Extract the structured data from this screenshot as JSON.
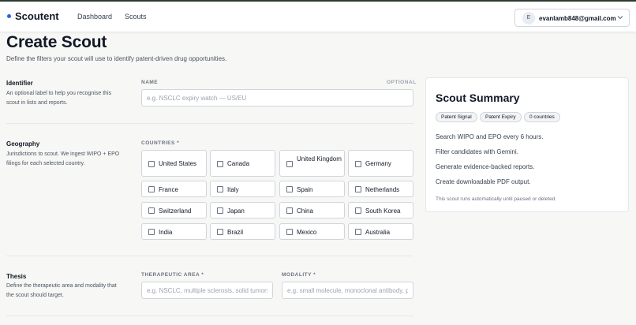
{
  "nav": {
    "brand": "Scoutent",
    "links": [
      "Dashboard",
      "Scouts"
    ],
    "account_initial": "E",
    "account_email": "evanlamb848@gmail.com",
    "brand_color": "#2563eb"
  },
  "page": {
    "title": "Create Scout",
    "subtitle": "Define the filters your scout will use to identify patent-driven drug opportunities."
  },
  "identifier": {
    "title": "Identifier",
    "description": "An optional label to help you recognise this scout in lists and reports.",
    "field_label": "NAME",
    "optional_tag": "OPTIONAL",
    "placeholder": "e.g. NSCLC expiry watch — US/EU",
    "value": ""
  },
  "geography": {
    "title": "Geography",
    "description": "Jurisdictions to scout. We ingest WIPO + EPO filings for each selected country.",
    "field_label": "COUNTRIES *",
    "countries": [
      {
        "label": "United States",
        "checked": false
      },
      {
        "label": "Canada",
        "checked": false
      },
      {
        "label": "United Kingdom",
        "checked": false
      },
      {
        "label": "Germany",
        "checked": false
      },
      {
        "label": "France",
        "checked": false
      },
      {
        "label": "Italy",
        "checked": false
      },
      {
        "label": "Spain",
        "checked": false
      },
      {
        "label": "Netherlands",
        "checked": false
      },
      {
        "label": "Switzerland",
        "checked": false
      },
      {
        "label": "Japan",
        "checked": false
      },
      {
        "label": "China",
        "checked": false
      },
      {
        "label": "South Korea",
        "checked": false
      },
      {
        "label": "India",
        "checked": false
      },
      {
        "label": "Brazil",
        "checked": false
      },
      {
        "label": "Mexico",
        "checked": false
      },
      {
        "label": "Australia",
        "checked": false
      }
    ]
  },
  "thesis": {
    "title": "Thesis",
    "description": "Define the therapeutic area and modality that the scout should target.",
    "therapeutic_label": "THERAPEUTIC AREA *",
    "therapeutic_placeholder": "e.g. NSCLC, multiple sclerosis, solid tumors.",
    "modality_label": "MODALITY *",
    "modality_placeholder": "e.g. small molecule, monoclonal antibody, p"
  },
  "summary": {
    "title": "Scout Summary",
    "pills": [
      "Patent Signal",
      "Patent Expiry",
      "0 countries"
    ],
    "lines": [
      "Search WIPO and EPO every 6 hours.",
      "Filter candidates with Gemini.",
      "Generate evidence-backed reports.",
      "Create downloadable PDF output."
    ],
    "note": "This scout runs automatically until paused or deleted."
  }
}
